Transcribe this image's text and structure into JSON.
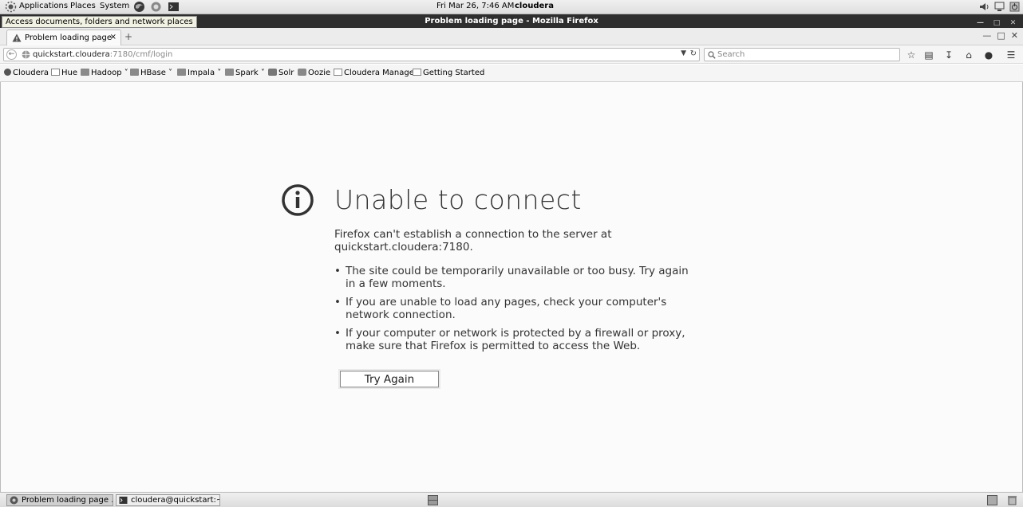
{
  "top_panel": {
    "menus": [
      "Applications",
      "Places",
      "System"
    ],
    "clock": "Fri Mar 26,  7:46 AM",
    "username": "cloudera"
  },
  "window": {
    "title": "Problem loading page - Mozilla Firefox",
    "tooltip": "Access documents, folders and network places"
  },
  "tab": {
    "label": "Problem loading page",
    "close": "×",
    "new_tab": "+"
  },
  "nav": {
    "url_host": "quickstart.cloudera",
    "url_path": ":7180/cmf/login",
    "search_placeholder": "Search"
  },
  "bookmarks": [
    "Cloudera",
    "Hue",
    "Hadoop",
    "HBase",
    "Impala",
    "Spark",
    "Solr",
    "Oozie",
    "Cloudera Manager",
    "Getting Started"
  ],
  "error": {
    "title": "Unable to connect",
    "description": "Firefox can't establish a connection to the server at quickstart.cloudera:7180.",
    "items": [
      "The site could be temporarily unavailable or too busy. Try again in a few moments.",
      "If you are unable to load any pages, check your computer's network connection.",
      "If your computer or network is protected by a firewall or proxy, make sure that Firefox is permitted to access the Web."
    ],
    "button": "Try Again"
  },
  "taskbar": {
    "items": [
      "Problem loading page ...",
      "cloudera@quickstart:~"
    ]
  }
}
